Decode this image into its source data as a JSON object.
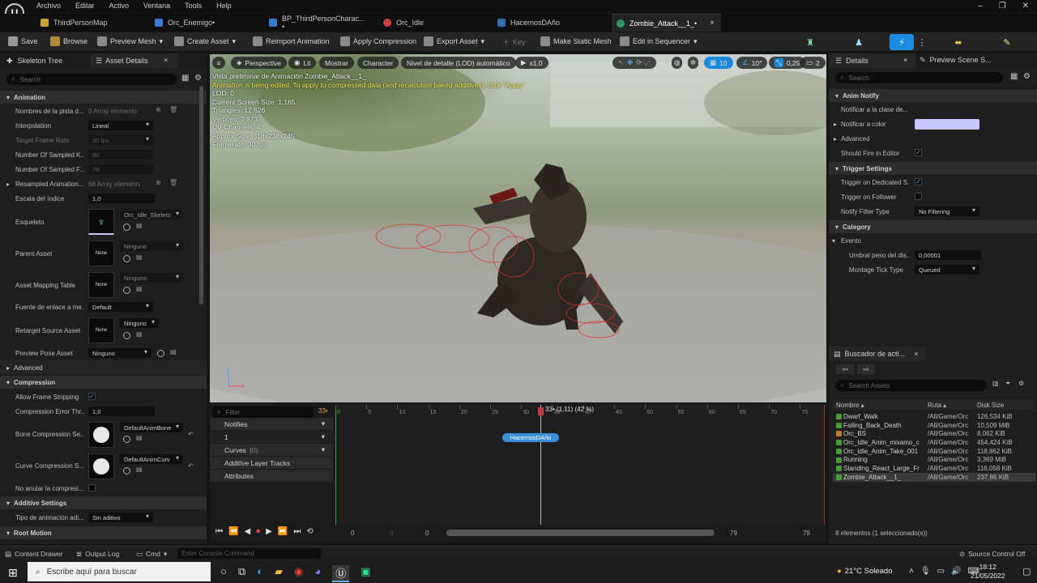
{
  "menubar": {
    "items": [
      "Archivo",
      "Editar",
      "Activo",
      "Ventana",
      "Tools",
      "Help"
    ],
    "logo": "U"
  },
  "tabs": [
    {
      "label": "ThirdPersonMap",
      "icon": "map-icon"
    },
    {
      "label": "Orc_Enemigo•",
      "icon": "blueprint-icon"
    },
    {
      "label": "BP_ThirdPersonCharac... •",
      "icon": "blueprint-icon"
    },
    {
      "label": "Orc_Idle",
      "icon": "animation-icon"
    },
    {
      "label": "HacernosDAño",
      "icon": "notify-icon"
    },
    {
      "label": "Zombie_Attack__1_•",
      "icon": "animation-icon",
      "close": "×"
    }
  ],
  "toolbar": {
    "save": "Save",
    "browse": "Browse",
    "preview_mesh": "Preview Mesh",
    "create_asset": "Create Asset",
    "reimport": "Reimport Animation",
    "apply_compression": "Apply Compression",
    "export_asset": "Export Asset",
    "key": "Key",
    "make_static_mesh": "Make Static Mesh",
    "edit_in_sequencer": "Edit in Sequencer"
  },
  "left_panel": {
    "tab_skeleton": "Skeleton Tree",
    "tab_details": "Asset Details",
    "close": "×",
    "search_placeholder": "Search",
    "cat_animation": "Animation",
    "track_names_label": "Nombres de la pista d...",
    "track_names_value": "0 Array elements",
    "interpolation_label": "Interpolation",
    "interpolation_value": "Lineal",
    "target_frame_label": "Target Frame Rate",
    "target_frame_value": "30 fps",
    "sampled_keys_label": "Number Of Sampled K...",
    "sampled_keys_value": "80",
    "sampled_frames_label": "Number Of Sampled F...",
    "sampled_frames_value": "79",
    "resampled_label": "Resampled Animation...",
    "resampled_value": "68 Array elements",
    "scale_label": "Escala del índice",
    "scale_value": "1,0",
    "skeleton_label": "Esqueleto",
    "skeleton_value": "Orc_Idle_Skeleto",
    "parent_label": "Parent Asset",
    "parent_value": "Ninguno",
    "parent_thumb": "None",
    "mapping_label": "Asset Mapping Table",
    "mapping_value": "Ninguno",
    "mapping_thumb": "None",
    "link_source_label": "Fuente de enlace a me...",
    "link_source_value": "Default",
    "retarget_label": "Retarget Source Asset",
    "retarget_value": "Ninguno",
    "retarget_thumb": "None",
    "preview_pose_label": "Preview Pose Asset",
    "preview_pose_value": "Ninguno",
    "cat_advanced": "Advanced",
    "cat_compression": "Compression",
    "frame_strip_label": "Allow Frame Stripping",
    "comp_error_label": "Compression Error Thr...",
    "comp_error_value": "1,0",
    "bone_comp_label": "Bone Compression Se...",
    "bone_comp_value": "DefaultAnimBone",
    "curve_comp_label": "Curve Compression S...",
    "curve_comp_value": "DefaultAnimCurv",
    "no_override_label": "No anular la compresi...",
    "cat_additive": "Additive Settings",
    "additive_type_label": "Tipo de animación adi...",
    "additive_type_value": "Sin aditivo",
    "cat_root_motion": "Root Motion"
  },
  "viewport": {
    "perspective": "Perspective",
    "lit": "Lit",
    "show": "Mostrar",
    "character": "Character",
    "lod": "Nivel de detalle (LOD) automático",
    "speed": "x1,0",
    "grid": "10",
    "angle": "10°",
    "scale": "0,25",
    "cam": "2",
    "info_lines": [
      "Vista preliminar de Animación Zombie_Attack__1_",
      "Animation is being edited. To apply to compressed data (and recalculate baked additives), click \"Apply\"",
      "LOD: 0",
      "Current Screen Size: 1,165",
      "Triangles: 12 626",
      "Vertices: 7 873",
      "UV Channels: 4",
      "Approx Size: 318x238x245",
      "Framerate: 30 fps"
    ]
  },
  "timeline": {
    "filter_placeholder": "Filter",
    "frame_counter": "33•",
    "notifies": "Notifies",
    "notify_track": "1",
    "curves": "Curves",
    "curves_count": "(0)",
    "additive_layer": "Additive Layer Tracks",
    "attributes": "Attributes",
    "ticks": [
      "0",
      "5",
      "10",
      "15",
      "20",
      "25",
      "30",
      "35",
      "40",
      "45",
      "50",
      "55",
      "60",
      "65",
      "70",
      "75"
    ],
    "playhead_label": "33• (1,11) (42 %)",
    "notify_name": "HacernosDAño",
    "range_start": "0",
    "range_start2": "0",
    "range_start3": "0",
    "range_end": "79",
    "range_end2": "79"
  },
  "right_panel": {
    "tab_details": "Details",
    "close": "×",
    "tab_preview": "Preview Scene S...",
    "search_placeholder": "Search",
    "cat_anim_notify": "Anim Notify",
    "notify_class": "Notificar a la clase de...",
    "notify_color": "Notificar a color",
    "advanced": "Advanced",
    "fire_editor": "Should Fire in Editor",
    "cat_trigger": "Trigger Settings",
    "trigger_dedicated": "Trigger on Dedicated S...",
    "trigger_follower": "Trigger on Follower",
    "filter_type_label": "Notify Filter Type",
    "filter_type_value": "No Filtering",
    "cat_category": "Category",
    "event": "Evento",
    "weight_label": "Umbral peso del dis...",
    "weight_value": "0,00001",
    "tick_type_label": "Montage Tick Type",
    "tick_type_value": "Queued",
    "color_swatch": "#c9c5ff"
  },
  "asset_browser": {
    "title": "Buscador de acti...",
    "close": "×",
    "search_placeholder": "Search Assets",
    "col_name": "Nombre",
    "col_path": "Ruta",
    "col_size": "Disk Size",
    "items": [
      {
        "name": "Dwarf_Walk",
        "path": "/All/Game/Orc",
        "size": "126,534 KiB"
      },
      {
        "name": "Falling_Back_Death",
        "path": "/All/Game/Orc",
        "size": "10,509 MiB"
      },
      {
        "name": "Orc_BS",
        "path": "/All/Game/Orc",
        "size": "8,062 KiB"
      },
      {
        "name": "Orc_Idle_Anim_mixamo_c",
        "path": "/All/Game/Orc",
        "size": "454,424 KiB"
      },
      {
        "name": "Orc_Idle_Anim_Take_001",
        "path": "/All/Game/Orc",
        "size": "118,862 KiB"
      },
      {
        "name": "Running",
        "path": "/All/Game/Orc",
        "size": "3,369 MiB"
      },
      {
        "name": "Standing_React_Large_Fr",
        "path": "/All/Game/Orc",
        "size": "116,058 KiB"
      },
      {
        "name": "Zombie_Attack__1_",
        "path": "/All/Game/Orc",
        "size": "237,86 KiB"
      }
    ],
    "footer": "8 elementos (1 seleccionado(s))"
  },
  "statusbar": {
    "content_drawer": "Content Drawer",
    "output_log": "Output Log",
    "cmd": "Cmd",
    "console_placeholder": "Enter Console Command",
    "source_control": "Source Control Off"
  },
  "taskbar": {
    "search_placeholder": "Escribe aquí para buscar",
    "weather": "21°C  Soleado",
    "time": "18:12",
    "date": "21/05/2022"
  },
  "colors": {
    "accent": "#1a8bde",
    "notify_bg": "#3b8fd8",
    "warning": "#f6f050",
    "playhead": "#c04040"
  }
}
